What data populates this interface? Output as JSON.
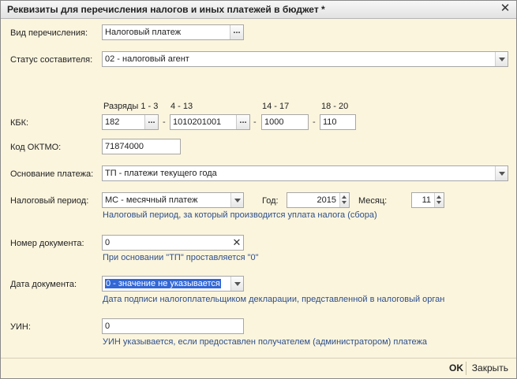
{
  "window": {
    "title": "Реквизиты для перечисления налогов и иных платежей в бюджет *"
  },
  "transfer_type": {
    "label": "Вид перечисления:",
    "value": "Налоговый платеж",
    "button": "..."
  },
  "compiler_status": {
    "label": "Статус составителя:",
    "value": "02 - налоговый агент"
  },
  "kbk": {
    "label": "КБК:",
    "headers": {
      "digits_1_3": "Разряды 1 - 3",
      "digits_4_13": "4 - 13",
      "digits_14_17": "14 - 17",
      "digits_18_20": "18 - 20"
    },
    "part1": "182",
    "part2": "1010201001",
    "part3": "1000",
    "part4": "110",
    "button": "...",
    "separator": "-"
  },
  "oktmo": {
    "label": "Код ОКТМО:",
    "value": "71874000"
  },
  "payment_basis": {
    "label": "Основание платежа:",
    "value": "ТП - платежи текущего года"
  },
  "tax_period": {
    "label": "Налоговый период:",
    "value": "МС - месячный платеж",
    "year_label": "Год:",
    "year": "2015",
    "month_label": "Месяц:",
    "month": "11",
    "hint": "Налоговый период, за который производится уплата налога (сбора)"
  },
  "document_number": {
    "label": "Номер документа:",
    "value": "0",
    "hint": "При основании \"ТП\" проставляется \"0\"",
    "clear": "✕"
  },
  "document_date": {
    "label": "Дата документа:",
    "value": "0 - значение не указывается",
    "hint": "Дата подписи налогоплательщиком декларации, представленной в налоговый орган"
  },
  "uin": {
    "label": "УИН:",
    "value": "0",
    "hint": "УИН указывается, если предоставлен получателем (администратором) платежа"
  },
  "footer": {
    "ok": "OK",
    "close": "Закрыть"
  },
  "icons": {
    "close": "close-icon",
    "dropdown": "chevron-down-icon",
    "spin": "spin-icon",
    "clear": "clear-icon"
  }
}
